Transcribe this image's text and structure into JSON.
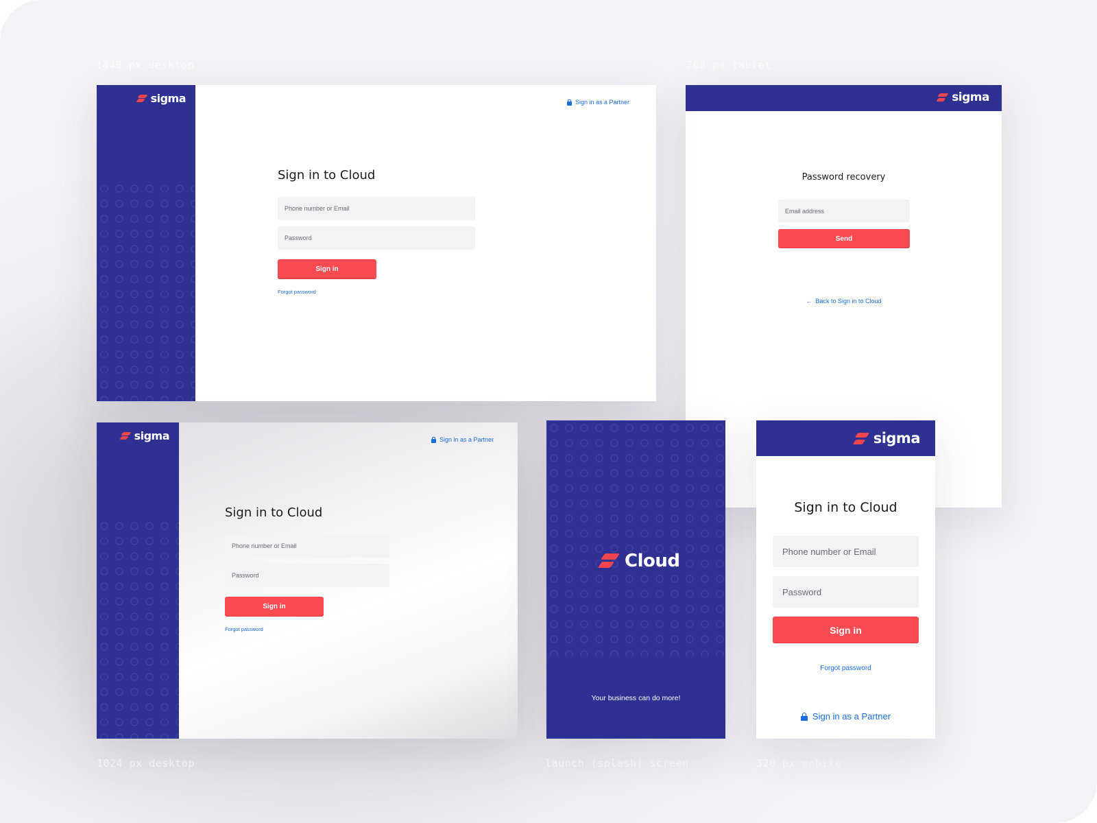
{
  "captions": {
    "desktop_1440": "1440 px desktop",
    "tablet_768": "768 px tablet",
    "desktop_1024": "1024 px desktop",
    "splash": "launch (splash) screen",
    "mobile_320": "320 px mobile"
  },
  "brand": {
    "name": "sigma",
    "primary_color": "#2e3192",
    "accent_color": "#fa4a52",
    "link_color": "#1a6cdc"
  },
  "desktop_1440": {
    "partner_link": "Sign in as a Partner",
    "title": "Sign in to Cloud",
    "login_placeholder": "Phone number or Email",
    "password_placeholder": "Password",
    "submit_label": "Sign in",
    "forgot_link": "Forgot password"
  },
  "tablet_768": {
    "title": "Password recovery",
    "email_placeholder": "Email address",
    "submit_label": "Send",
    "back_link": "Back to Sign in to Cloud"
  },
  "desktop_1024": {
    "partner_link": "Sign in as a Partner",
    "title": "Sign in to Cloud",
    "login_placeholder": "Phone number or Email",
    "password_placeholder": "Password",
    "submit_label": "Sign in",
    "forgot_link": "Forgot password"
  },
  "splash": {
    "product_name": "Cloud",
    "tagline": "Your business can do more!"
  },
  "mobile_320": {
    "title": "Sign in to Cloud",
    "login_placeholder": "Phone number or Email",
    "password_placeholder": "Password",
    "submit_label": "Sign in",
    "forgot_link": "Forgot password",
    "partner_link": "Sign in as a Partner"
  }
}
